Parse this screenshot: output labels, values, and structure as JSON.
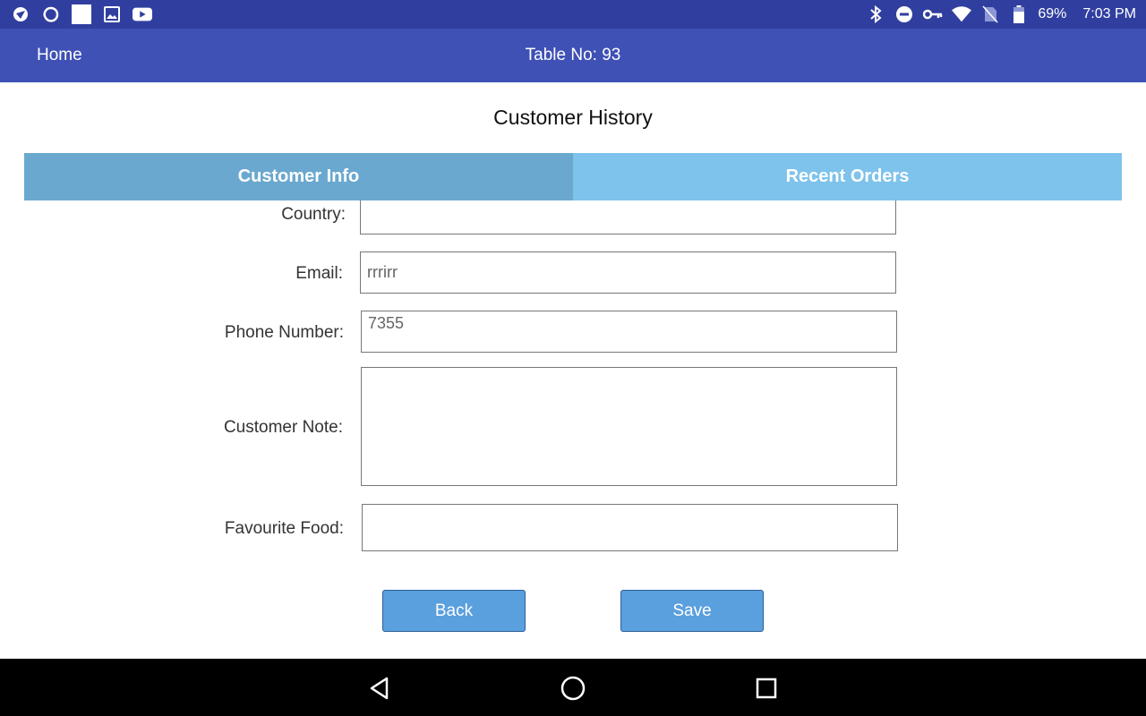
{
  "status_bar": {
    "battery": "69%",
    "time": "7:03 PM"
  },
  "app_bar": {
    "home_label": "Home",
    "table_label": "Table No: 93"
  },
  "page": {
    "title": "Customer History"
  },
  "tabs": [
    {
      "label": "Customer Info",
      "active": true
    },
    {
      "label": "Recent Orders",
      "active": false
    }
  ],
  "form": {
    "country": {
      "label": "Country:",
      "value": ""
    },
    "email": {
      "label": "Email:",
      "value": "rrrirr"
    },
    "phone": {
      "label": "Phone Number:",
      "value": "7355"
    },
    "note": {
      "label": "Customer Note:",
      "value": ""
    },
    "food": {
      "label": "Favourite Food:",
      "value": ""
    }
  },
  "buttons": {
    "back": "Back",
    "save": "Save"
  },
  "colors": {
    "status_bar": "#303f9f",
    "app_bar": "#3f51b5",
    "tab_active": "#6aa8cf",
    "tab_inactive": "#7ec3eb",
    "button": "#5a9fde"
  }
}
